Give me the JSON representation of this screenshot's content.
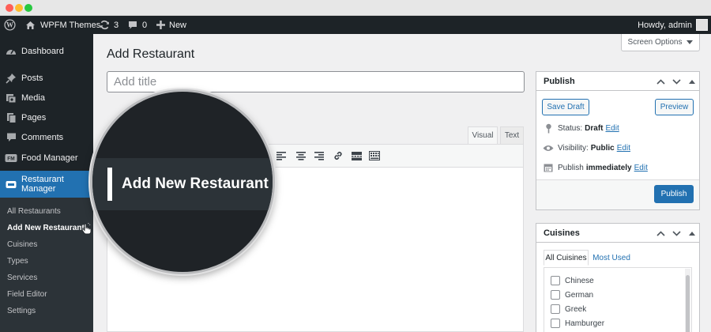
{
  "window": {
    "buttons": [
      {
        "name": "close",
        "color": "#ff5f57"
      },
      {
        "name": "minimize",
        "color": "#febc2e"
      },
      {
        "name": "maximize",
        "color": "#28c840"
      }
    ]
  },
  "adminbar": {
    "site_name": "WPFM Themes",
    "updates_count": "3",
    "comments_count": "0",
    "new_label": "New",
    "greeting": "Howdy, admin"
  },
  "sidebar": {
    "items": [
      {
        "label": "Dashboard",
        "icon": "dashboard-icon"
      },
      {
        "label": "Posts",
        "icon": "pin-icon"
      },
      {
        "label": "Media",
        "icon": "media-icon"
      },
      {
        "label": "Pages",
        "icon": "pages-icon"
      },
      {
        "label": "Comments",
        "icon": "comment-icon"
      },
      {
        "label": "Food Manager",
        "icon": "food-manager-icon"
      },
      {
        "label": "Restaurant Manager",
        "icon": "restaurant-icon"
      }
    ],
    "submenu": [
      "All Restaurants",
      "Add New Restaurant",
      "Cuisines",
      "Types",
      "Services",
      "Field Editor",
      "Settings"
    ]
  },
  "main": {
    "page_title": "Add Restaurant",
    "screen_options": "Screen Options",
    "title_placeholder": "Add title",
    "editor_tabs": [
      "Visual",
      "Text"
    ]
  },
  "magnifier": {
    "label": "Add New Restaurant"
  },
  "publish": {
    "title": "Publish",
    "save_draft": "Save Draft",
    "preview": "Preview",
    "status_label": "Status:",
    "status_value": "Draft",
    "visibility_label": "Visibility:",
    "visibility_value": "Public",
    "publish_label": "Publish",
    "publish_value": "immediately",
    "edit_link": "Edit",
    "publish_button": "Publish"
  },
  "cuisines": {
    "title": "Cuisines",
    "tabs": [
      "All Cuisines",
      "Most Used"
    ],
    "items": [
      "Chinese",
      "German",
      "Greek",
      "Hamburger"
    ]
  },
  "colors": {
    "admin_bg": "#1d2327",
    "accent": "#2271b1",
    "submenu_bg": "#2c3338"
  }
}
